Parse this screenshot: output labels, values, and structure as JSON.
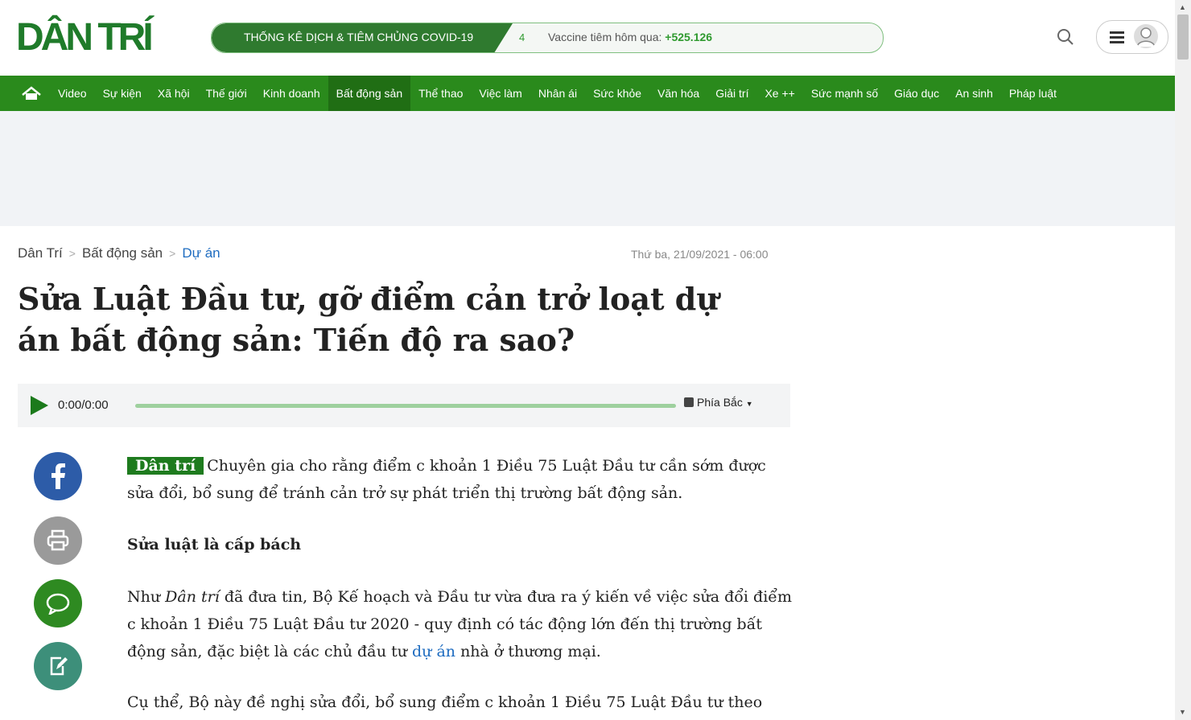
{
  "header": {
    "logo": "DÂN TRÍ",
    "covid_title": "THỐNG KÊ DỊCH & TIÊM CHỦNG COVID-19",
    "covid_count": "4",
    "vaccine_label": "Vaccine tiêm hôm qua: ",
    "vaccine_value": "+525.126"
  },
  "nav": {
    "items": [
      "Video",
      "Sự kiện",
      "Xã hội",
      "Thế giới",
      "Kinh doanh",
      "Bất động sản",
      "Thể thao",
      "Việc làm",
      "Nhân ái",
      "Sức khỏe",
      "Văn hóa",
      "Giải trí",
      "Xe ++",
      "Sức mạnh số",
      "Giáo dục",
      "An sinh",
      "Pháp luật"
    ],
    "active": "Bất động sản"
  },
  "breadcrumb": {
    "home": "Dân Trí",
    "section": "Bất động sản",
    "sub": "Dự án"
  },
  "date": "Thứ ba, 21/09/2021 - 06:00",
  "title": "Sửa Luật Đầu tư, gỡ điểm cản trở loạt dự án bất động sản: Tiến độ ra sao?",
  "player": {
    "time": "0:00/0:00",
    "voice": "Phía Bắc"
  },
  "article": {
    "badge": "Dân trí",
    "sapo": "Chuyên gia cho rằng điểm c khoản 1 Điều 75 Luật Đầu tư cần sớm được sửa đổi, bổ sung để tránh cản trở sự phát triển thị trường bất động sản.",
    "subheading": "Sửa luật là cấp bách",
    "p1_a": "Như ",
    "p1_italic": "Dân trí",
    "p1_b": " đã đưa tin, Bộ Kế hoạch và Đầu tư vừa đưa ra ý kiến về việc sửa đổi điểm c khoản 1 Điều 75 Luật Đầu tư 2020 - quy định có tác động lớn đến thị trường bất động sản, đặc biệt là các chủ đầu tư ",
    "p1_link": "dự án",
    "p1_c": " nhà ở thương mại.",
    "p2": "Cụ thể, Bộ này đề nghị sửa đổi, bổ sung điểm c khoản 1 Điều 75 Luật Đầu tư theo"
  },
  "colors": {
    "brand_green": "#2a8a1c",
    "link_blue": "#1e6cc0"
  }
}
